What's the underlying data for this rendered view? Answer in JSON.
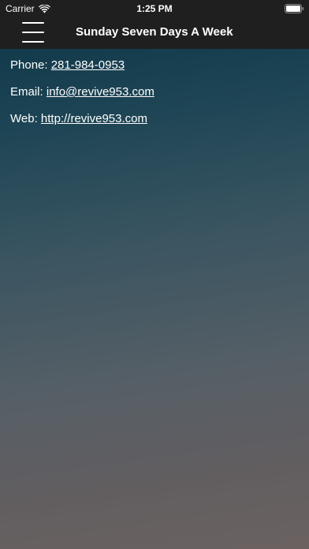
{
  "status_bar": {
    "carrier": "Carrier",
    "time": "1:25 PM"
  },
  "nav": {
    "title": "Sunday Seven Days A Week",
    "menu_icon": "hamburger-menu-icon"
  },
  "contact": {
    "phone_label": "Phone:",
    "phone_value": "281-984-0953",
    "email_label": "Email:",
    "email_value": "info@revive953.com",
    "web_label": "Web:",
    "web_value": "http://revive953.com"
  },
  "colors": {
    "bar_background": "#1f1f1f",
    "gradient_top": "#0c3446",
    "gradient_bottom": "#6a6261",
    "text": "#ffffff"
  }
}
